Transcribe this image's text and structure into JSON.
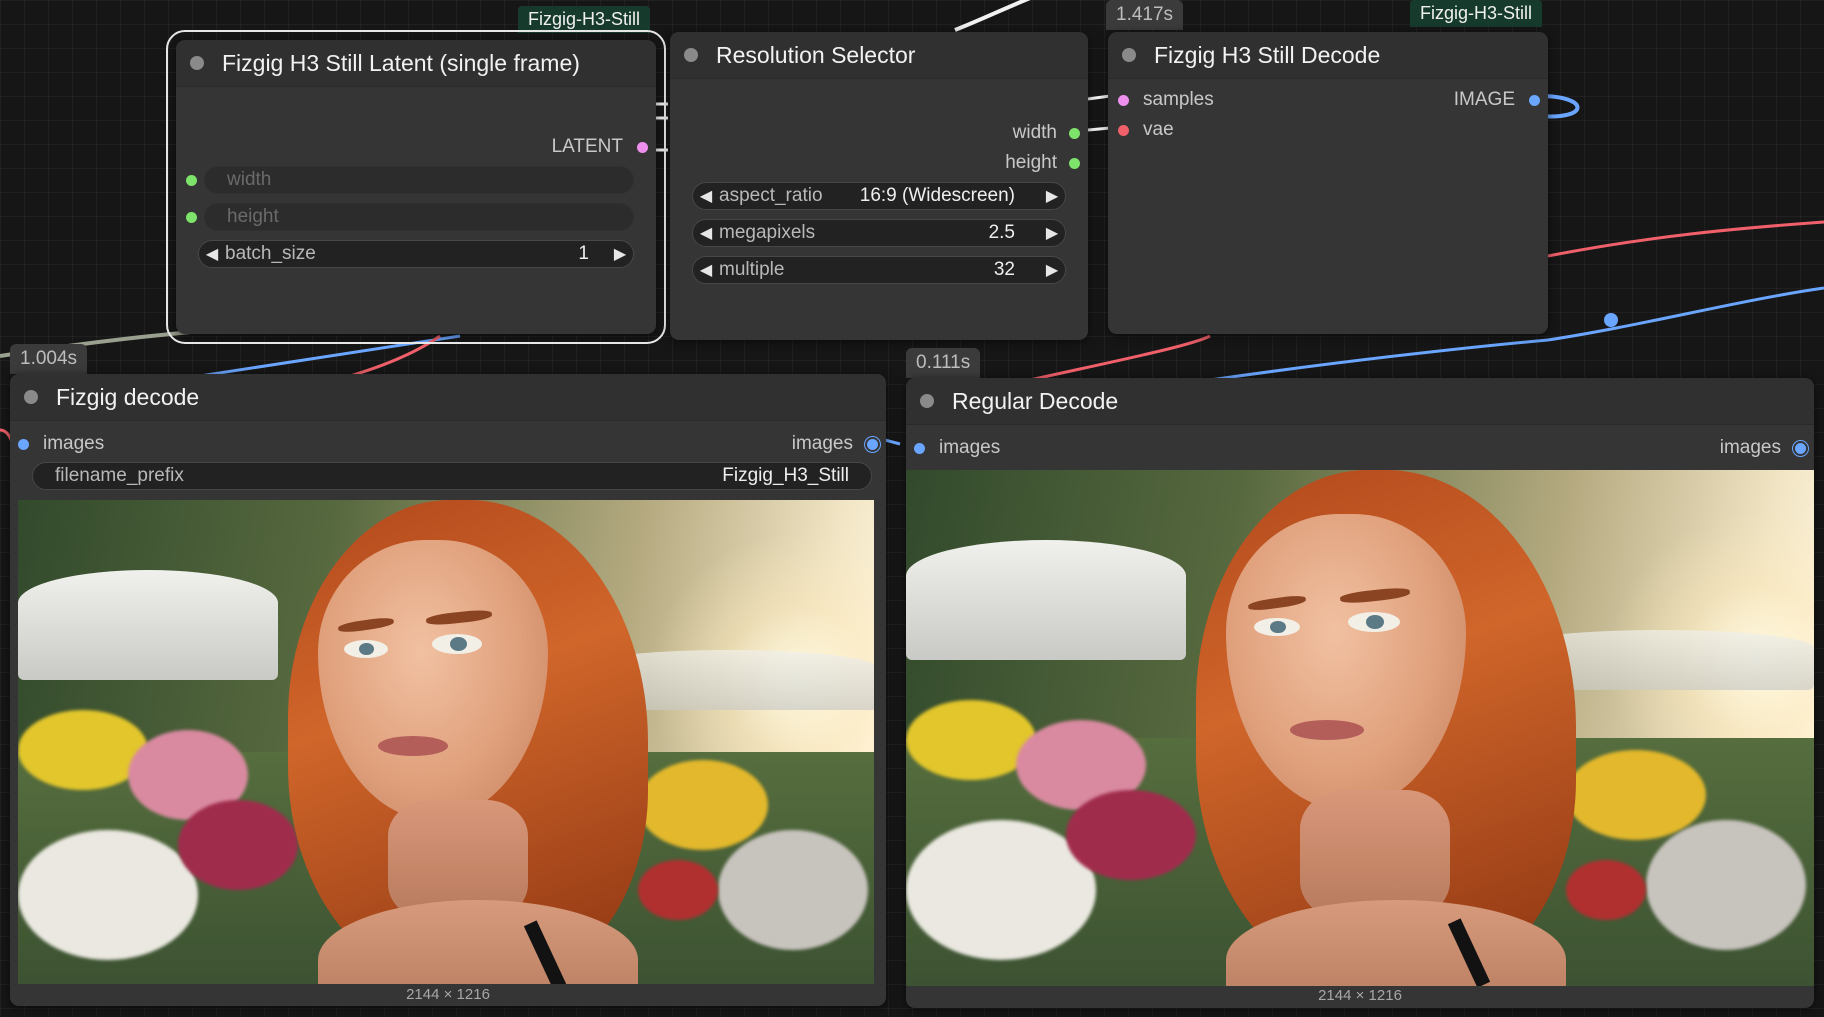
{
  "groups": {
    "left_tag": "Fizgig-H3-Still",
    "right_tag": "Fizgig-H3-Still"
  },
  "badges": {
    "decode_time": "1.417s",
    "fizgig_decode_time": "1.004s",
    "regular_decode_time": "0.111s"
  },
  "latent_node": {
    "title": "Fizgig H3 Still Latent (single frame)",
    "output_label": "LATENT",
    "width_label": "width",
    "height_label": "height",
    "batch_size_label": "batch_size",
    "batch_size_value": "1"
  },
  "resolution_node": {
    "title": "Resolution Selector",
    "out_width": "width",
    "out_height": "height",
    "aspect_ratio_label": "aspect_ratio",
    "aspect_ratio_value": "16:9 (Widescreen)",
    "megapixels_label": "megapixels",
    "megapixels_value": "2.5",
    "multiple_label": "multiple",
    "multiple_value": "32"
  },
  "still_decode_node": {
    "title": "Fizgig H3 Still Decode",
    "input_samples": "samples",
    "input_vae": "vae",
    "output_image": "IMAGE"
  },
  "fizgig_decode_node": {
    "title": "Fizgig decode",
    "input_images": "images",
    "output_images": "images",
    "filename_prefix_label": "filename_prefix",
    "filename_prefix_value": "Fizgig_H3_Still",
    "image_dims": "2144 × 1216"
  },
  "regular_decode_node": {
    "title": "Regular Decode",
    "input_images": "images",
    "output_images": "images",
    "image_dims": "2144 × 1216"
  },
  "colors": {
    "canvas": "#161616",
    "node_body": "#353535",
    "latent_wire": "#ee8fee",
    "vae_wire": "#f0606a",
    "image_wire": "#6aa6ff",
    "int_wire": "#7ee36a",
    "group_tag": "#163a2c"
  }
}
